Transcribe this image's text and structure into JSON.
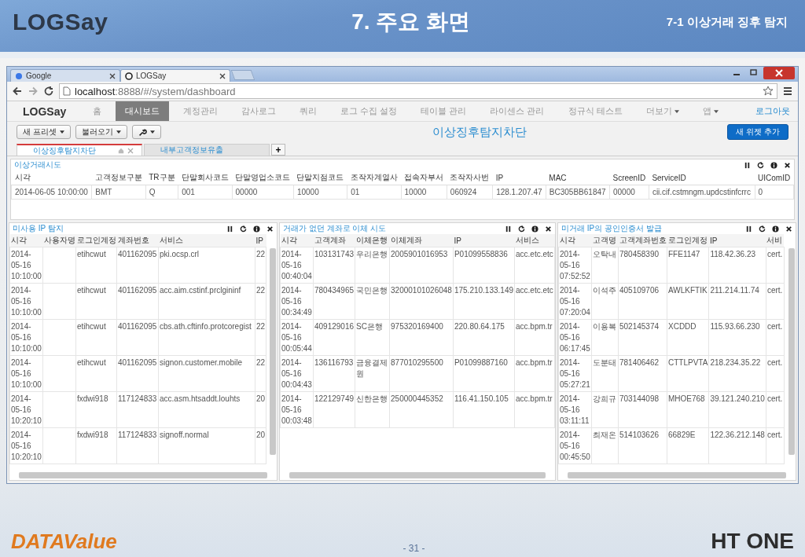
{
  "slide": {
    "logo": "LOGSay",
    "title": "7. 주요 화면",
    "subtitle": "7-1 이상거래 징후 탐지",
    "footer_logo": "DATAValue",
    "page": "- 31 -",
    "footer_brand": "HT ONE"
  },
  "browser": {
    "tabs": [
      {
        "title": "Google",
        "selected": false
      },
      {
        "title": "LOGSay",
        "selected": true
      }
    ],
    "url_host": "localhost",
    "url_rest": ":8888/#/system/dashboard"
  },
  "app": {
    "logo": "LOGSay",
    "nav": [
      {
        "label": "홈",
        "selected": false,
        "dropdown": false
      },
      {
        "label": "대시보드",
        "selected": true,
        "dropdown": false
      },
      {
        "label": "계정관리",
        "selected": false,
        "dropdown": false
      },
      {
        "label": "감사로그",
        "selected": false,
        "dropdown": false
      },
      {
        "label": "쿼리",
        "selected": false,
        "dropdown": false
      },
      {
        "label": "로그 수집 설정",
        "selected": false,
        "dropdown": false
      },
      {
        "label": "테이블 관리",
        "selected": false,
        "dropdown": false
      },
      {
        "label": "라이센스 관리",
        "selected": false,
        "dropdown": false
      },
      {
        "label": "정규식 테스트",
        "selected": false,
        "dropdown": false
      },
      {
        "label": "더보기",
        "selected": false,
        "dropdown": true
      },
      {
        "label": "앱",
        "selected": false,
        "dropdown": true
      }
    ],
    "logout": "로그아웃",
    "toolbar": [
      {
        "kind": "text",
        "label": "새 프리셋"
      },
      {
        "kind": "text",
        "label": "불러오기"
      },
      {
        "kind": "wrench"
      }
    ],
    "page_title": "이상징후탐지차단",
    "add_button": "새 위젯 추가",
    "tabs": [
      {
        "label": "이상징후탐지차단",
        "selected": true
      },
      {
        "label": "내부고객정보유출",
        "selected": false
      }
    ],
    "add_tab": "+"
  },
  "top_widget": {
    "title": "이상거래시도",
    "columns": [
      "시각",
      "고객정보구분",
      "TR구분",
      "단말회사코드",
      "단말영업소코드",
      "단말지점코드",
      "조작자계열사",
      "접속자부서",
      "조작자사번",
      "IP",
      "MAC",
      "ScreenID",
      "ServiceID",
      "UIComID"
    ],
    "rows": [
      [
        "2014-06-05 10:00:00",
        "BMT",
        "Q",
        "001",
        "00000",
        "10000",
        "01",
        "10000",
        "060924",
        "128.1.207.47",
        "BC305BB61847",
        "00000",
        "cii.cif.cstmngm.updcstinfcrrc",
        "0"
      ]
    ]
  },
  "widgets": [
    {
      "title": "미사용 IP 탐지",
      "columns": [
        "시각",
        "사용자명",
        "로그인계정",
        "계좌번호",
        "서비스",
        "IP"
      ],
      "rows": [
        [
          "2014-05-16 10:10:00",
          null,
          "etihcwut",
          "401162095",
          "pki.ocsp.crl",
          "22"
        ],
        [
          "2014-05-16 10:10:00",
          null,
          "etihcwut",
          "401162095",
          "acc.aim.cstinf.prclgininf",
          "22"
        ],
        [
          "2014-05-16 10:10:00",
          null,
          "etihcwut",
          "401162095",
          "cbs.ath.cftinfo.protcoregist",
          "22"
        ],
        [
          "2014-05-16 10:10:00",
          null,
          "etihcwut",
          "401162095",
          "signon.customer.mobile",
          "22"
        ],
        [
          "2014-05-16 10:20:10",
          null,
          "fxdwi918",
          "117124833",
          "acc.asm.htsaddt.louhts",
          "20"
        ],
        [
          "2014-05-16 10:20:10",
          null,
          "fxdwi918",
          "117124833",
          "signoff.normal",
          "20"
        ]
      ]
    },
    {
      "title": "거래가 없던 계좌로 이체 시도",
      "columns": [
        "시각",
        "고객계좌",
        "이체은행",
        "이체계좌",
        "IP",
        "서비스"
      ],
      "rows": [
        [
          "2014-05-16 00:40:04",
          "103131743",
          "우리은행",
          "2005901016953",
          "P01099558836",
          "acc.etc.etc"
        ],
        [
          "2014-05-16 00:34:49",
          "780434965",
          "국민은행",
          "32000101026048",
          "175.210.133.149",
          "acc.etc.etc"
        ],
        [
          "2014-05-16 00:05:44",
          "409129016",
          "SC은행",
          "975320169400",
          "220.80.64.175",
          "acc.bpm.tr"
        ],
        [
          "2014-05-16 00:04:43",
          "136116793",
          "금융결제원",
          "877010295500",
          "P01099887160",
          "acc.bpm.tr"
        ],
        [
          "2014-05-16 00:03:48",
          "122129749",
          "신한은행",
          "250000445352",
          "116.41.150.105",
          "acc.bpm.tr"
        ]
      ]
    },
    {
      "title": "미거래 IP의 공인인증서 발급",
      "columns": [
        "시각",
        "고객명",
        "고객계좌번호",
        "로그인계정",
        "IP",
        "서비"
      ],
      "rows": [
        [
          "2014-05-16 07:52:52",
          "오탁내",
          "780458390",
          "FFE1147",
          "118.42.36.23",
          "cert."
        ],
        [
          "2014-05-16 07:20:04",
          "이석주",
          "405109706",
          "AWLKFTIK",
          "211.214.11.74",
          "cert."
        ],
        [
          "2014-05-16 06:17:45",
          "이용복",
          "502145374",
          "XCDDD",
          "115.93.66.230",
          "cert."
        ],
        [
          "2014-05-16 05:27:21",
          "도분태",
          "781406462",
          "CTTLPVTA",
          "218.234.35.22",
          "cert."
        ],
        [
          "2014-05-16 03:11:11",
          "강희규",
          "703144098",
          "MHOE768",
          "39.121.240.210",
          "cert."
        ],
        [
          "2014-05-16 00:45:50",
          "최재온",
          "514103626",
          "66829E",
          "122.36.212.148",
          "cert."
        ]
      ]
    }
  ]
}
